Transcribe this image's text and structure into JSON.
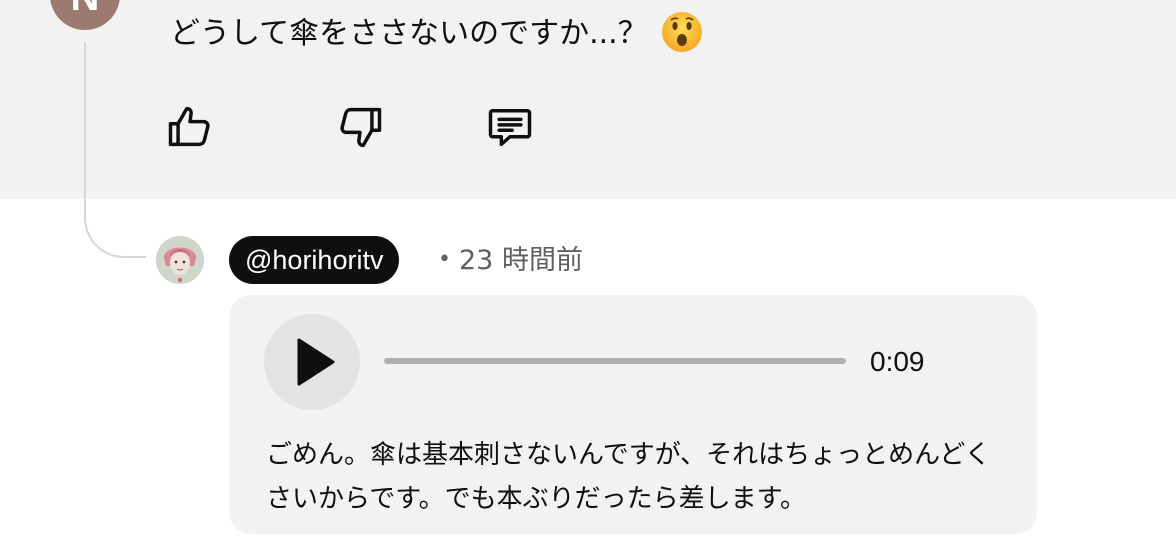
{
  "parent_comment": {
    "avatar_initial": "N",
    "text": "どうして傘をささないのですか...？",
    "emoji_icon": "hushed-face-emoji",
    "actions": {
      "like_icon": "thumbs-up-icon",
      "dislike_icon": "thumbs-down-icon",
      "reply_icon": "comment-icon"
    }
  },
  "reply": {
    "handle": "@horihoritv",
    "separator": "•",
    "timestamp": "23 時間前",
    "audio": {
      "play_icon": "play-icon",
      "progress": 0,
      "duration": "0:09"
    },
    "transcript": "ごめん。傘は基本刺さないんですが、それはちょっとめんどくさいからです。でも本ぶりだったら差します。"
  },
  "colors": {
    "surface": "#f2f2f2",
    "chip": "#0f0f0f",
    "secondary_text": "#606060",
    "avatar": "#9b7b70"
  }
}
